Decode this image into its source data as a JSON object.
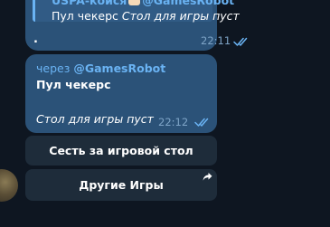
{
  "previous_message": {
    "reply_author": "USPA-койся",
    "reply_author_suffix": "@GamesRobot",
    "reply_pool": "Пул чекерс",
    "reply_status": "Стол для игры пуст",
    "body": ".",
    "time": "22:11",
    "read_status": "read"
  },
  "bot_message": {
    "via_prefix": "через",
    "bot_username": "@GamesRobot",
    "pool_title": "Пул чекерс",
    "table_status": "Стол для игры пуст",
    "time": "22:12",
    "read_status": "read"
  },
  "inline_keyboard": {
    "sit_label": "Сесть за игровой стол",
    "other_games_label": "Другие Игры"
  },
  "colors": {
    "background": "#0e1621",
    "bubble": "#2b5278",
    "link": "#6ab3f3",
    "keyboard_button": "#1e2c3a"
  },
  "icons": {
    "read_ticks": "double-check-icon",
    "share": "share-arrow-icon",
    "avatar": "user-avatar"
  }
}
